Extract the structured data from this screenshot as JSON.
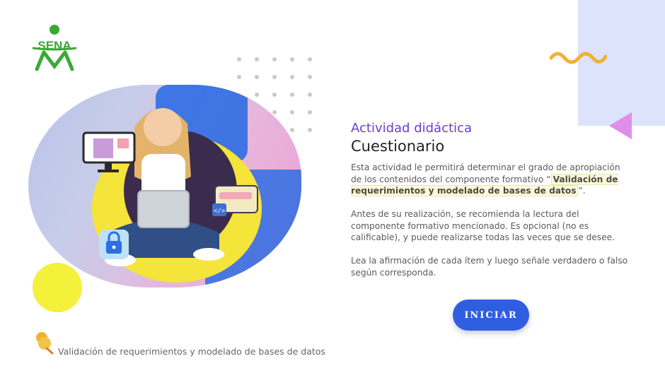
{
  "brand": {
    "logo_text": "SENA",
    "color": "#39a935"
  },
  "activity": {
    "eyebrow": "Actividad didáctica",
    "title": "Cuestionario"
  },
  "paragraphs": {
    "p1_before": "Esta actividad le permitirá determinar el grado de apropiación de los contenidos del componente formativo “",
    "p1_highlight": "Validación de requerimientos y modelado de bases de datos",
    "p1_after": "”.",
    "p2": "Antes de su realización, se recomienda la lectura del componente formativo mencionado.  Es opcional (no es calificable), y puede realizarse todas las veces que se desee.",
    "p3": "Lea la afirmación de cada ítem y luego señale verdadero o falso según corresponda."
  },
  "start_button": {
    "label": "INICIAR",
    "color": "#2f5ee0"
  },
  "footer": {
    "text": "Validación de requerimientos y modelado de bases de datos"
  },
  "colors": {
    "accent_purple": "#6a3fcf",
    "lavender": "#dde3fb",
    "pink": "#e08ee9",
    "yellow": "#f5f03a",
    "orange_wave": "#f0b233"
  },
  "icons": [
    "sena-logo-icon",
    "lock-icon",
    "code-icon",
    "monitor-icon",
    "laptop-icon",
    "pin-icon",
    "wave-icon"
  ]
}
